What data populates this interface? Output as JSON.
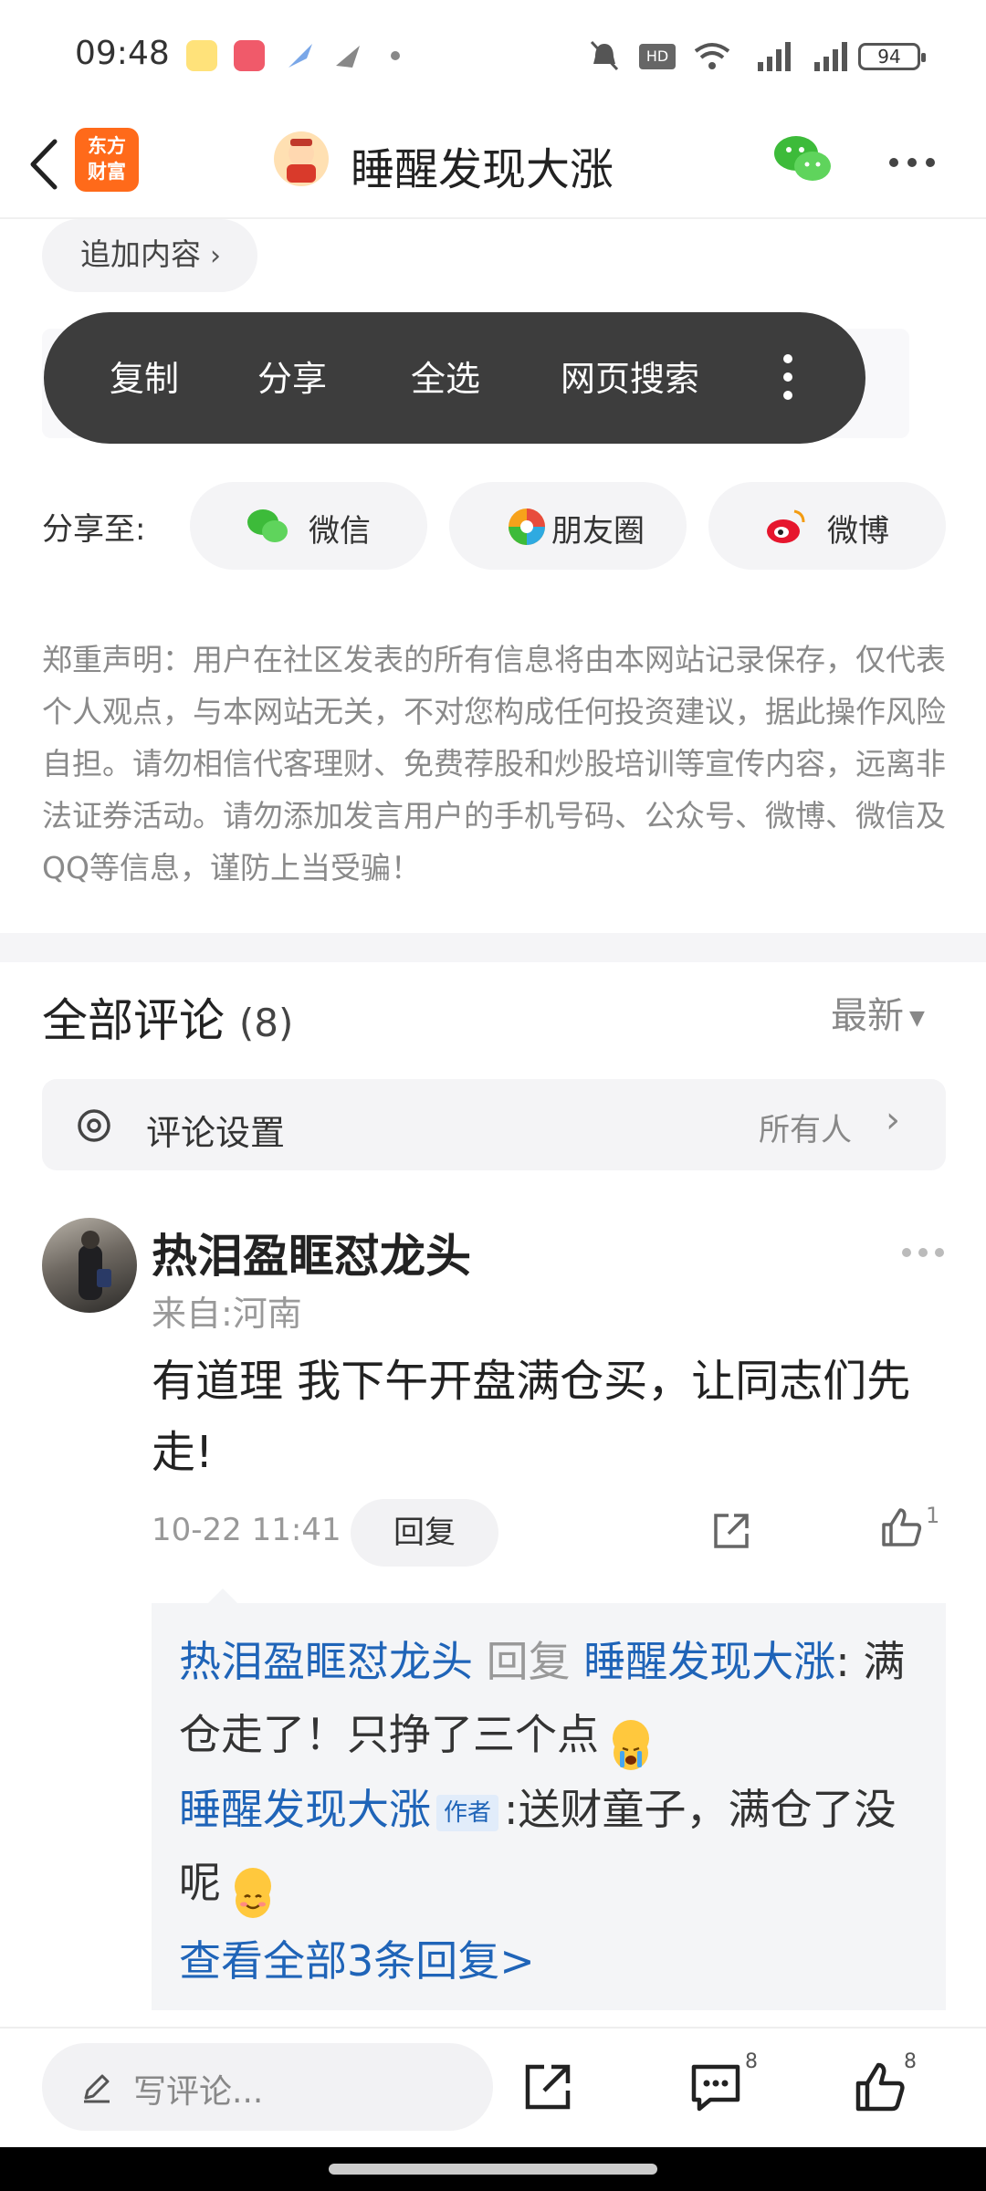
{
  "status_bar": {
    "time": "09:48",
    "battery": "94"
  },
  "header": {
    "back_icon": "chevron-left-icon",
    "app_logo_lines": [
      "东方",
      "财富"
    ],
    "title": "睡醒发现大涨",
    "share_icon": "wechat-icon",
    "more_icon": "more-dots-icon"
  },
  "add_content": {
    "label": "追加内容"
  },
  "popup_menu": {
    "items": [
      "复制",
      "分享",
      "全选",
      "网页搜索"
    ]
  },
  "share": {
    "label": "分享至:",
    "targets": [
      {
        "label": "微信",
        "icon": "wechat-icon",
        "color": "#3dbb3a"
      },
      {
        "label": "朋友圈",
        "icon": "moments-icon",
        "color": "#f7a21b"
      },
      {
        "label": "微博",
        "icon": "weibo-icon",
        "color": "#e6162d"
      }
    ]
  },
  "disclaimer": "郑重声明：用户在社区发表的所有信息将由本网站记录保存，仅代表个人观点，与本网站无关，不对您构成任何投资建议，据此操作风险自担。请勿相信代客理财、免费荐股和炒股培训等宣传内容，远离非法证券活动。请勿添加发言用户的手机号码、公众号、微博、微信及QQ等信息，谨防上当受骗！",
  "comments": {
    "title": "全部评论",
    "count": "(8)",
    "sort": "最新",
    "settings_label": "评论设置",
    "settings_value": "所有人",
    "items": [
      {
        "user": "热泪盈眶怼龙头",
        "from": "来自:河南",
        "text": "有道理 我下午开盘满仓买，让同志们先走!",
        "time": "10-22 11:41",
        "reply_label": "回复",
        "likes": "1",
        "replies": [
          {
            "from_user": "热泪盈眶怼龙头",
            "reply_word": "回复",
            "to_user": "睡醒发现大涨",
            "sep": ":",
            "text": "满仓走了！只挣了三个点"
          },
          {
            "from_user": "睡醒发现大涨",
            "tag": "作者",
            "sep": ":",
            "text": "送财童子，满仓了没呢"
          }
        ],
        "view_all": "查看全部3条回复>"
      }
    ]
  },
  "bottom_bar": {
    "placeholder": "写评论...",
    "comment_count": "8",
    "like_count": "8"
  },
  "colors": {
    "link_blue": "#1f64b8",
    "popup_bg": "#3d3d3d",
    "brand_orange": "#ff6a1a"
  }
}
